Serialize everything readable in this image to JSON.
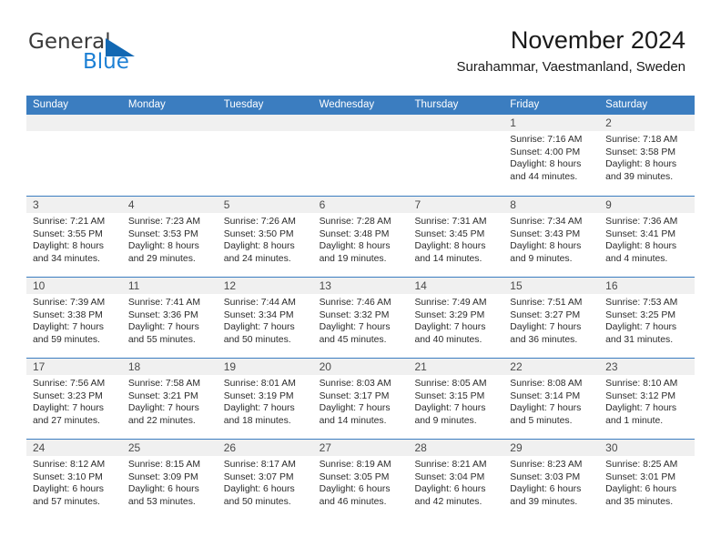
{
  "brand": {
    "name_part1": "General",
    "name_part2": "Blue",
    "accent_color": "#1268b3",
    "text_color": "#3a3a3a"
  },
  "header": {
    "title": "November 2024",
    "location": "Surahammar, Vaestmanland, Sweden"
  },
  "calendar": {
    "header_bg_color": "#3b7dc0",
    "daynum_band_color": "#f0f0f0",
    "weekdays": [
      "Sunday",
      "Monday",
      "Tuesday",
      "Wednesday",
      "Thursday",
      "Friday",
      "Saturday"
    ],
    "weeks": [
      [
        {
          "day": "",
          "sunrise": "",
          "sunset": "",
          "daylight1": "",
          "daylight2": ""
        },
        {
          "day": "",
          "sunrise": "",
          "sunset": "",
          "daylight1": "",
          "daylight2": ""
        },
        {
          "day": "",
          "sunrise": "",
          "sunset": "",
          "daylight1": "",
          "daylight2": ""
        },
        {
          "day": "",
          "sunrise": "",
          "sunset": "",
          "daylight1": "",
          "daylight2": ""
        },
        {
          "day": "",
          "sunrise": "",
          "sunset": "",
          "daylight1": "",
          "daylight2": ""
        },
        {
          "day": "1",
          "sunrise": "Sunrise: 7:16 AM",
          "sunset": "Sunset: 4:00 PM",
          "daylight1": "Daylight: 8 hours",
          "daylight2": "and 44 minutes."
        },
        {
          "day": "2",
          "sunrise": "Sunrise: 7:18 AM",
          "sunset": "Sunset: 3:58 PM",
          "daylight1": "Daylight: 8 hours",
          "daylight2": "and 39 minutes."
        }
      ],
      [
        {
          "day": "3",
          "sunrise": "Sunrise: 7:21 AM",
          "sunset": "Sunset: 3:55 PM",
          "daylight1": "Daylight: 8 hours",
          "daylight2": "and 34 minutes."
        },
        {
          "day": "4",
          "sunrise": "Sunrise: 7:23 AM",
          "sunset": "Sunset: 3:53 PM",
          "daylight1": "Daylight: 8 hours",
          "daylight2": "and 29 minutes."
        },
        {
          "day": "5",
          "sunrise": "Sunrise: 7:26 AM",
          "sunset": "Sunset: 3:50 PM",
          "daylight1": "Daylight: 8 hours",
          "daylight2": "and 24 minutes."
        },
        {
          "day": "6",
          "sunrise": "Sunrise: 7:28 AM",
          "sunset": "Sunset: 3:48 PM",
          "daylight1": "Daylight: 8 hours",
          "daylight2": "and 19 minutes."
        },
        {
          "day": "7",
          "sunrise": "Sunrise: 7:31 AM",
          "sunset": "Sunset: 3:45 PM",
          "daylight1": "Daylight: 8 hours",
          "daylight2": "and 14 minutes."
        },
        {
          "day": "8",
          "sunrise": "Sunrise: 7:34 AM",
          "sunset": "Sunset: 3:43 PM",
          "daylight1": "Daylight: 8 hours",
          "daylight2": "and 9 minutes."
        },
        {
          "day": "9",
          "sunrise": "Sunrise: 7:36 AM",
          "sunset": "Sunset: 3:41 PM",
          "daylight1": "Daylight: 8 hours",
          "daylight2": "and 4 minutes."
        }
      ],
      [
        {
          "day": "10",
          "sunrise": "Sunrise: 7:39 AM",
          "sunset": "Sunset: 3:38 PM",
          "daylight1": "Daylight: 7 hours",
          "daylight2": "and 59 minutes."
        },
        {
          "day": "11",
          "sunrise": "Sunrise: 7:41 AM",
          "sunset": "Sunset: 3:36 PM",
          "daylight1": "Daylight: 7 hours",
          "daylight2": "and 55 minutes."
        },
        {
          "day": "12",
          "sunrise": "Sunrise: 7:44 AM",
          "sunset": "Sunset: 3:34 PM",
          "daylight1": "Daylight: 7 hours",
          "daylight2": "and 50 minutes."
        },
        {
          "day": "13",
          "sunrise": "Sunrise: 7:46 AM",
          "sunset": "Sunset: 3:32 PM",
          "daylight1": "Daylight: 7 hours",
          "daylight2": "and 45 minutes."
        },
        {
          "day": "14",
          "sunrise": "Sunrise: 7:49 AM",
          "sunset": "Sunset: 3:29 PM",
          "daylight1": "Daylight: 7 hours",
          "daylight2": "and 40 minutes."
        },
        {
          "day": "15",
          "sunrise": "Sunrise: 7:51 AM",
          "sunset": "Sunset: 3:27 PM",
          "daylight1": "Daylight: 7 hours",
          "daylight2": "and 36 minutes."
        },
        {
          "day": "16",
          "sunrise": "Sunrise: 7:53 AM",
          "sunset": "Sunset: 3:25 PM",
          "daylight1": "Daylight: 7 hours",
          "daylight2": "and 31 minutes."
        }
      ],
      [
        {
          "day": "17",
          "sunrise": "Sunrise: 7:56 AM",
          "sunset": "Sunset: 3:23 PM",
          "daylight1": "Daylight: 7 hours",
          "daylight2": "and 27 minutes."
        },
        {
          "day": "18",
          "sunrise": "Sunrise: 7:58 AM",
          "sunset": "Sunset: 3:21 PM",
          "daylight1": "Daylight: 7 hours",
          "daylight2": "and 22 minutes."
        },
        {
          "day": "19",
          "sunrise": "Sunrise: 8:01 AM",
          "sunset": "Sunset: 3:19 PM",
          "daylight1": "Daylight: 7 hours",
          "daylight2": "and 18 minutes."
        },
        {
          "day": "20",
          "sunrise": "Sunrise: 8:03 AM",
          "sunset": "Sunset: 3:17 PM",
          "daylight1": "Daylight: 7 hours",
          "daylight2": "and 14 minutes."
        },
        {
          "day": "21",
          "sunrise": "Sunrise: 8:05 AM",
          "sunset": "Sunset: 3:15 PM",
          "daylight1": "Daylight: 7 hours",
          "daylight2": "and 9 minutes."
        },
        {
          "day": "22",
          "sunrise": "Sunrise: 8:08 AM",
          "sunset": "Sunset: 3:14 PM",
          "daylight1": "Daylight: 7 hours",
          "daylight2": "and 5 minutes."
        },
        {
          "day": "23",
          "sunrise": "Sunrise: 8:10 AM",
          "sunset": "Sunset: 3:12 PM",
          "daylight1": "Daylight: 7 hours",
          "daylight2": "and 1 minute."
        }
      ],
      [
        {
          "day": "24",
          "sunrise": "Sunrise: 8:12 AM",
          "sunset": "Sunset: 3:10 PM",
          "daylight1": "Daylight: 6 hours",
          "daylight2": "and 57 minutes."
        },
        {
          "day": "25",
          "sunrise": "Sunrise: 8:15 AM",
          "sunset": "Sunset: 3:09 PM",
          "daylight1": "Daylight: 6 hours",
          "daylight2": "and 53 minutes."
        },
        {
          "day": "26",
          "sunrise": "Sunrise: 8:17 AM",
          "sunset": "Sunset: 3:07 PM",
          "daylight1": "Daylight: 6 hours",
          "daylight2": "and 50 minutes."
        },
        {
          "day": "27",
          "sunrise": "Sunrise: 8:19 AM",
          "sunset": "Sunset: 3:05 PM",
          "daylight1": "Daylight: 6 hours",
          "daylight2": "and 46 minutes."
        },
        {
          "day": "28",
          "sunrise": "Sunrise: 8:21 AM",
          "sunset": "Sunset: 3:04 PM",
          "daylight1": "Daylight: 6 hours",
          "daylight2": "and 42 minutes."
        },
        {
          "day": "29",
          "sunrise": "Sunrise: 8:23 AM",
          "sunset": "Sunset: 3:03 PM",
          "daylight1": "Daylight: 6 hours",
          "daylight2": "and 39 minutes."
        },
        {
          "day": "30",
          "sunrise": "Sunrise: 8:25 AM",
          "sunset": "Sunset: 3:01 PM",
          "daylight1": "Daylight: 6 hours",
          "daylight2": "and 35 minutes."
        }
      ]
    ]
  }
}
